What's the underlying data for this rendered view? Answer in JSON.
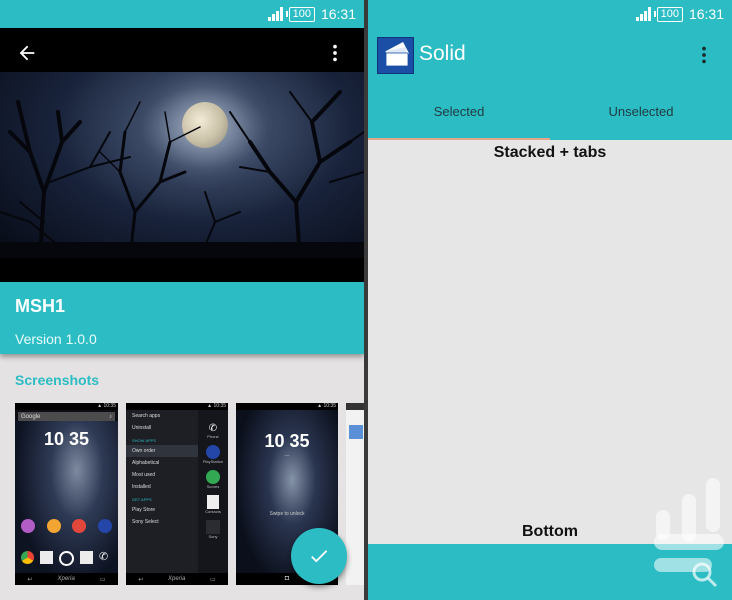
{
  "status": {
    "battery": "100",
    "time": "16:31"
  },
  "left": {
    "app_title": "MSH1",
    "app_version": "Version 1.0.0",
    "screenshots_title": "Screenshots",
    "shots": {
      "s1": {
        "time": "10 35",
        "search": "Google"
      },
      "s2": {
        "menu": [
          "Search apps",
          "Uninstall",
          "SHOW APPS",
          "Own order",
          "Alphabetical",
          "Most used",
          "Installed",
          "GET APPS",
          "Play Store",
          "Sony Select"
        ],
        "side": [
          "Phone",
          "PlayStation",
          "Scores",
          "Contacts",
          "Sony"
        ]
      },
      "s3": {
        "time": "10 35",
        "swipe": "Swipe to unlock"
      }
    },
    "brand": "Xperia"
  },
  "right": {
    "title": "Solid",
    "tabs": [
      "Selected",
      "Unselected"
    ],
    "content_top": "Stacked + tabs",
    "content_bottom": "Bottom"
  }
}
